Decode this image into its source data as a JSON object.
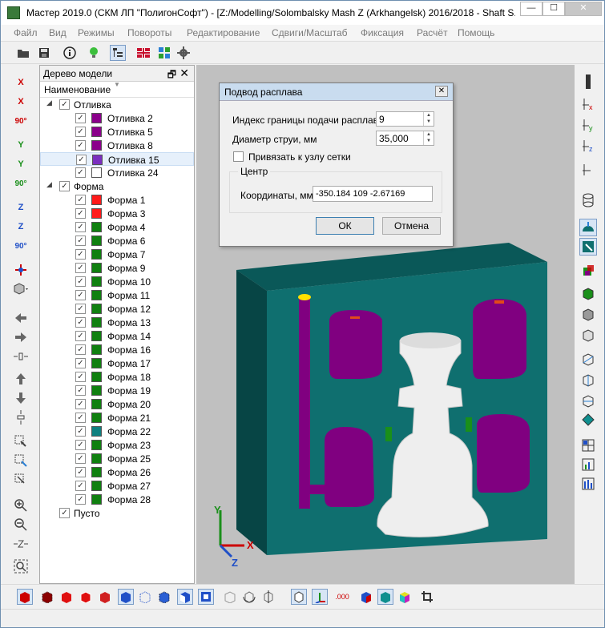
{
  "title_bar": {
    "title": "Мастер 2019.0 (СКМ ЛП \"ПолигонСофт\") - [Z:/Modelling/Solombalsky Mash Z (Arkhangelsk) 2016/2018 - Shaft S...",
    "minimize": "—",
    "maximize": "☐",
    "close": "✕"
  },
  "menu": [
    "Файл",
    "Вид",
    "Режимы",
    "Повороты",
    "Редактирование",
    "Сдвиги/Масштаб",
    "Фиксация",
    "Расчёт",
    "Помощь"
  ],
  "left_toolbar": {
    "rot_x_1": "X",
    "rot_x_2": "X",
    "deg_x": "90°",
    "rot_y_1": "Y",
    "rot_y_2": "Y",
    "deg_y": "90°",
    "rot_z_1": "Z",
    "rot_z_2": "Z",
    "deg_z": "90°"
  },
  "model_tree": {
    "panel_title": "Дерево модели",
    "float_glyph": "🗗",
    "close_glyph": "✕",
    "column_header": "Наименование",
    "nodes": [
      {
        "label": "Отливка",
        "level": 0,
        "expander": "◢",
        "checked": true,
        "color": null,
        "selected": false
      },
      {
        "label": "Отливка 2",
        "level": 1,
        "expander": "",
        "checked": true,
        "color": "#8b008b",
        "selected": false
      },
      {
        "label": "Отливка 5",
        "level": 1,
        "expander": "",
        "checked": true,
        "color": "#8b008b",
        "selected": false
      },
      {
        "label": "Отливка 8",
        "level": 1,
        "expander": "",
        "checked": true,
        "color": "#8b008b",
        "selected": false
      },
      {
        "label": "Отливка 15",
        "level": 1,
        "expander": "",
        "checked": true,
        "color": "#7b2fbf",
        "selected": true
      },
      {
        "label": "Отливка 24",
        "level": 1,
        "expander": "",
        "checked": true,
        "color": "#ffffff",
        "selected": false
      },
      {
        "label": "Форма",
        "level": 0,
        "expander": "◢",
        "checked": true,
        "color": null,
        "selected": false
      },
      {
        "label": "Форма 1",
        "level": 1,
        "expander": "",
        "checked": true,
        "color": "#ff1a1a",
        "selected": false
      },
      {
        "label": "Форма 3",
        "level": 1,
        "expander": "",
        "checked": true,
        "color": "#ff1a1a",
        "selected": false
      },
      {
        "label": "Форма 4",
        "level": 1,
        "expander": "",
        "checked": true,
        "color": "#108010",
        "selected": false
      },
      {
        "label": "Форма 6",
        "level": 1,
        "expander": "",
        "checked": true,
        "color": "#108010",
        "selected": false
      },
      {
        "label": "Форма 7",
        "level": 1,
        "expander": "",
        "checked": true,
        "color": "#108010",
        "selected": false
      },
      {
        "label": "Форма 9",
        "level": 1,
        "expander": "",
        "checked": true,
        "color": "#108010",
        "selected": false
      },
      {
        "label": "Форма 10",
        "level": 1,
        "expander": "",
        "checked": true,
        "color": "#108010",
        "selected": false
      },
      {
        "label": "Форма 11",
        "level": 1,
        "expander": "",
        "checked": true,
        "color": "#108010",
        "selected": false
      },
      {
        "label": "Форма 12",
        "level": 1,
        "expander": "",
        "checked": true,
        "color": "#108010",
        "selected": false
      },
      {
        "label": "Форма 13",
        "level": 1,
        "expander": "",
        "checked": true,
        "color": "#108010",
        "selected": false
      },
      {
        "label": "Форма 14",
        "level": 1,
        "expander": "",
        "checked": true,
        "color": "#108010",
        "selected": false
      },
      {
        "label": "Форма 16",
        "level": 1,
        "expander": "",
        "checked": true,
        "color": "#108010",
        "selected": false
      },
      {
        "label": "Форма 17",
        "level": 1,
        "expander": "",
        "checked": true,
        "color": "#108010",
        "selected": false
      },
      {
        "label": "Форма 18",
        "level": 1,
        "expander": "",
        "checked": true,
        "color": "#108010",
        "selected": false
      },
      {
        "label": "Форма 19",
        "level": 1,
        "expander": "",
        "checked": true,
        "color": "#108010",
        "selected": false
      },
      {
        "label": "Форма 20",
        "level": 1,
        "expander": "",
        "checked": true,
        "color": "#108010",
        "selected": false
      },
      {
        "label": "Форма 21",
        "level": 1,
        "expander": "",
        "checked": true,
        "color": "#108010",
        "selected": false
      },
      {
        "label": "Форма 22",
        "level": 1,
        "expander": "",
        "checked": true,
        "color": "#0f8080",
        "selected": false
      },
      {
        "label": "Форма 23",
        "level": 1,
        "expander": "",
        "checked": true,
        "color": "#108010",
        "selected": false
      },
      {
        "label": "Форма 25",
        "level": 1,
        "expander": "",
        "checked": true,
        "color": "#108010",
        "selected": false
      },
      {
        "label": "Форма 26",
        "level": 1,
        "expander": "",
        "checked": true,
        "color": "#108010",
        "selected": false
      },
      {
        "label": "Форма 27",
        "level": 1,
        "expander": "",
        "checked": true,
        "color": "#108010",
        "selected": false
      },
      {
        "label": "Форма 28",
        "level": 1,
        "expander": "",
        "checked": true,
        "color": "#108010",
        "selected": false
      },
      {
        "label": "Пусто",
        "level": 0,
        "expander": "",
        "checked": true,
        "color": null,
        "selected": false
      }
    ]
  },
  "dialog": {
    "title": "Подвод расплава",
    "close_glyph": "✕",
    "gate_index_label": "Индекс границы подачи расплава",
    "gate_index_value": "9",
    "stream_diameter_label": "Диаметр струи, мм",
    "stream_diameter_value": "35,000",
    "snap_label": "Привязать к узлу сетки",
    "snap_checked": false,
    "group_title": "Центр",
    "coords_label": "Координаты, мм",
    "coords_value": "-350.184 109 -2.67169",
    "ok_label": "ОК",
    "cancel_label": "Отмена"
  },
  "viewport": {
    "axis_x": "X",
    "axis_y": "Y",
    "axis_z": "Z",
    "colors": {
      "background": "#c0c0c0",
      "mold": "#0f6f6f",
      "mold_dark": "#0a4f4f",
      "casting": "#800080",
      "shaft": "#f2f2f2",
      "gate_marker": "#ffe000",
      "green_part": "#1a8f1a"
    }
  },
  "bottom_toolbar": {
    "dots_label": ".000"
  }
}
